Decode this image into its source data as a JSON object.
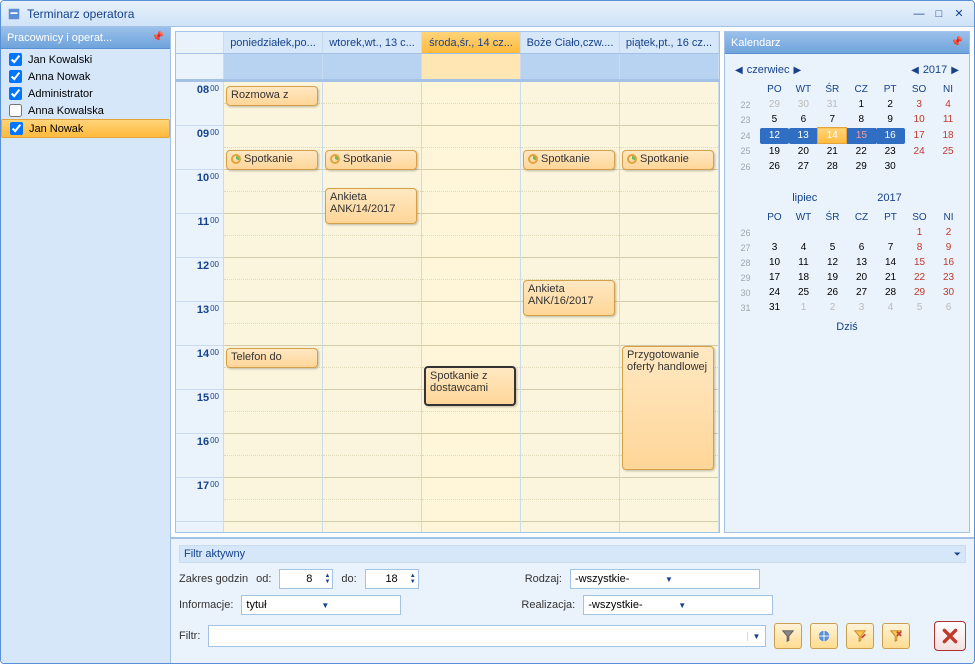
{
  "window": {
    "title": "Terminarz operatora"
  },
  "sidebar": {
    "header": "Pracownicy i operat...",
    "employees": [
      {
        "name": "Jan Kowalski",
        "checked": true,
        "selected": false
      },
      {
        "name": "Anna Nowak",
        "checked": true,
        "selected": false
      },
      {
        "name": "Administrator",
        "checked": true,
        "selected": false
      },
      {
        "name": "Anna Kowalska",
        "checked": false,
        "selected": false
      },
      {
        "name": "Jan Nowak",
        "checked": true,
        "selected": true
      }
    ]
  },
  "schedule": {
    "days": [
      {
        "label": "poniedziałek,po...",
        "current": false
      },
      {
        "label": "wtorek,wt., 13 c...",
        "current": false
      },
      {
        "label": "środa,śr., 14 cz...",
        "current": true
      },
      {
        "label": "Boże Ciało,czw....",
        "current": false
      },
      {
        "label": "piątek,pt., 16 cz...",
        "current": false
      }
    ],
    "hours": [
      "08",
      "09",
      "10",
      "11",
      "12",
      "13",
      "14",
      "15",
      "16",
      "17"
    ],
    "events": {
      "e1": {
        "title": "Rozmowa z"
      },
      "e2": {
        "title": "Spotkanie"
      },
      "e3": {
        "title": "Spotkanie"
      },
      "e4": {
        "title": "Spotkanie"
      },
      "e5": {
        "title": "Spotkanie"
      },
      "e6": {
        "title": "Ankieta ANK/14/2017"
      },
      "e7": {
        "title": "Ankieta ANK/16/2017"
      },
      "e8": {
        "title": "Telefon do"
      },
      "e9": {
        "title": "Spotkanie z dostawcami"
      },
      "e10": {
        "title": "Przygotowanie oferty handlowej"
      }
    }
  },
  "calendar": {
    "header": "Kalendarz",
    "month1": {
      "name": "czerwiec",
      "year": "2017"
    },
    "month2": {
      "name": "lipiec",
      "year": "2017"
    },
    "dow": [
      "PO",
      "WT",
      "ŚR",
      "CZ",
      "PT",
      "SO",
      "NI"
    ],
    "today_label": "Dziś"
  },
  "filter": {
    "header": "Filtr aktywny",
    "range_label": "Zakres godzin",
    "from_label": "od:",
    "to_label": "do:",
    "from_value": "8",
    "to_value": "18",
    "kind_label": "Rodzaj:",
    "kind_value": "-wszystkie-",
    "realization_label": "Realizacja:",
    "realization_value": "-wszystkie-",
    "info_label": "Informacje:",
    "info_value": "tytuł",
    "filtr_label": "Filtr:"
  }
}
